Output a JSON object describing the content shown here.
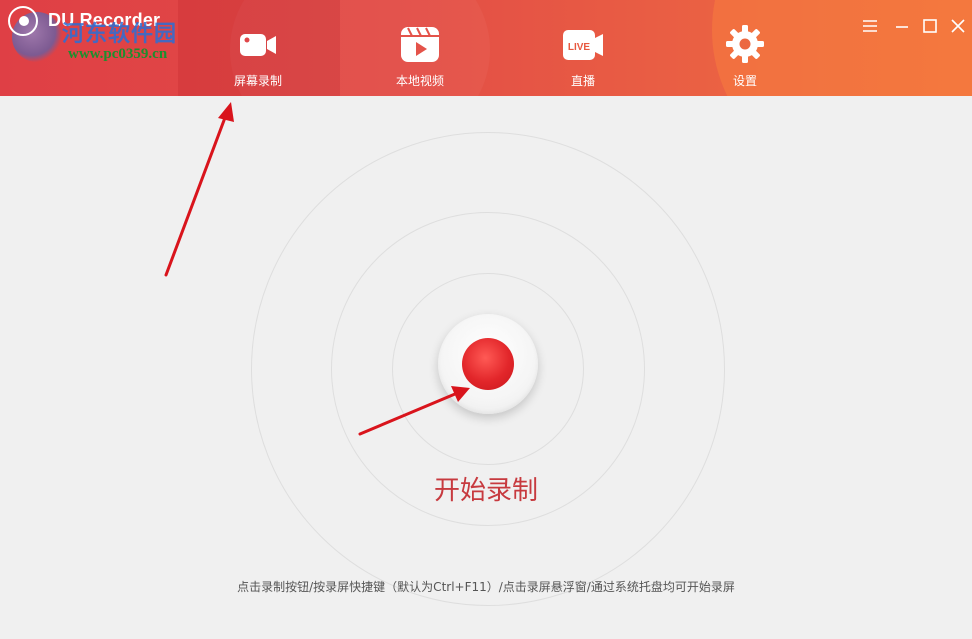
{
  "app": {
    "title": "DU Recorder",
    "watermark_line1": "河东软件园",
    "watermark_line2": "www.pc0359.cn"
  },
  "nav": {
    "items": [
      {
        "label": "屏幕录制",
        "icon": "video-camera-icon",
        "active": true
      },
      {
        "label": "本地视频",
        "icon": "video-file-icon",
        "active": false
      },
      {
        "label": "直播",
        "icon": "live-camera-icon",
        "active": false
      },
      {
        "label": "设置",
        "icon": "gear-icon",
        "active": false
      }
    ],
    "live_badge": "LIVE"
  },
  "window_controls": [
    "menu-icon",
    "minimize-icon",
    "maximize-icon",
    "close-icon"
  ],
  "main": {
    "record_label": "开始录制",
    "hint": "点击录制按钮/按录屏快捷键（默认为Ctrl+F11）/点击录屏悬浮窗/通过系统托盘均可开始录屏"
  },
  "colors": {
    "header_start": "#df3f45",
    "header_end": "#ee6e3f",
    "record_red": "#e2262a",
    "record_text": "#c73a3f",
    "annotation_arrow": "#d9141c"
  }
}
